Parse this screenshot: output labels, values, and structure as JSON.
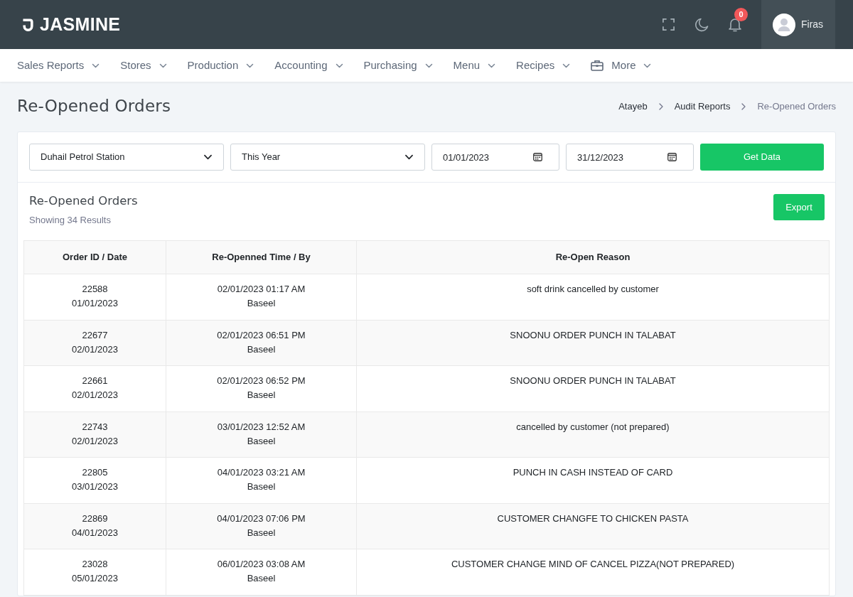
{
  "header": {
    "logo_text": "JASMINE",
    "notification_count": "0",
    "user_name": "Firas"
  },
  "menu": [
    {
      "label": "Sales Reports",
      "kind": "dropdown"
    },
    {
      "label": "Stores",
      "kind": "dropdown"
    },
    {
      "label": "Production",
      "kind": "dropdown"
    },
    {
      "label": "Accounting",
      "kind": "dropdown"
    },
    {
      "label": "Purchasing",
      "kind": "dropdown"
    },
    {
      "label": "Menu",
      "kind": "dropdown"
    },
    {
      "label": "Recipes",
      "kind": "dropdown"
    },
    {
      "label": "More",
      "kind": "icon-dropdown"
    }
  ],
  "page": {
    "title": "Re-Opened Orders",
    "breadcrumb": [
      {
        "label": "Atayeb",
        "active": false
      },
      {
        "label": "Audit Reports",
        "active": false
      },
      {
        "label": "Re-Opened Orders",
        "active": true
      }
    ]
  },
  "filters": [
    {
      "kind": "select",
      "value": "Duhail Petrol Station"
    },
    {
      "kind": "select",
      "value": "This Year"
    },
    {
      "kind": "date",
      "value": "01/01/2023"
    },
    {
      "kind": "date",
      "value": "31/12/2023"
    },
    {
      "kind": "button",
      "label": "Get Data"
    }
  ],
  "report": {
    "title": "Re-Opened Orders",
    "summary": "Showing 34 Results",
    "export_label": "Export",
    "table": {
      "columns": [
        "Order ID / Date",
        "Re-Openned Time / By",
        "Re-Open Reason"
      ],
      "rows": [
        {
          "order_id": "22588",
          "order_date": "01/01/2023",
          "reopened_time": "02/01/2023 01:17 AM",
          "reopened_by": "Baseel",
          "reason": "soft drink cancelled by customer"
        },
        {
          "order_id": "22677",
          "order_date": "02/01/2023",
          "reopened_time": "02/01/2023 06:51 PM",
          "reopened_by": "Baseel",
          "reason": "SNOONU ORDER PUNCH IN TALABAT"
        },
        {
          "order_id": "22661",
          "order_date": "02/01/2023",
          "reopened_time": "02/01/2023 06:52 PM",
          "reopened_by": "Baseel",
          "reason": "SNOONU ORDER PUNCH IN TALABAT"
        },
        {
          "order_id": "22743",
          "order_date": "02/01/2023",
          "reopened_time": "03/01/2023 12:52 AM",
          "reopened_by": "Baseel",
          "reason": "cancelled by customer (not prepared)"
        },
        {
          "order_id": "22805",
          "order_date": "03/01/2023",
          "reopened_time": "04/01/2023 03:21 AM",
          "reopened_by": "Baseel",
          "reason": "PUNCH IN CASH INSTEAD OF CARD"
        },
        {
          "order_id": "22869",
          "order_date": "04/01/2023",
          "reopened_time": "04/01/2023 07:06 PM",
          "reopened_by": "Baseel",
          "reason": "CUSTOMER CHANGFE TO CHICKEN PASTA"
        },
        {
          "order_id": "23028",
          "order_date": "05/01/2023",
          "reopened_time": "06/01/2023 03:08 AM",
          "reopened_by": "Baseel",
          "reason": "CUSTOMER CHANGE MIND OF CANCEL PIZZA(NOT PREPARED)"
        }
      ]
    }
  }
}
